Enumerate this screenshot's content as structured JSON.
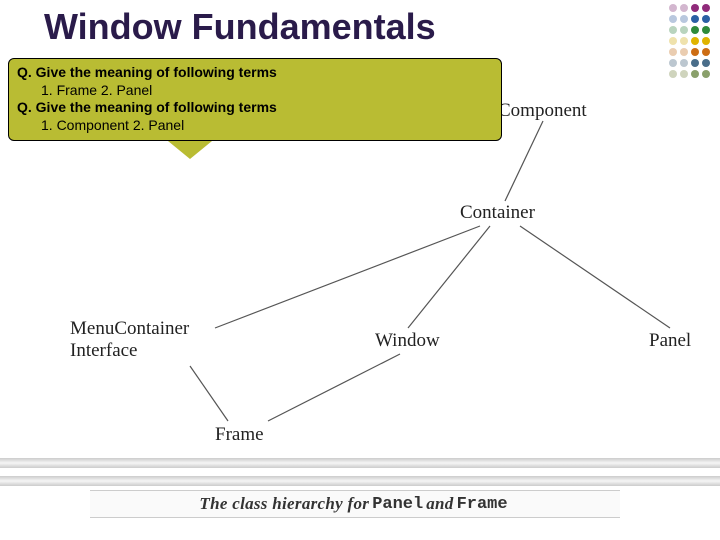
{
  "title": "Window Fundamentals",
  "callout": {
    "q1": "Q.  Give the meaning of following terms",
    "q1_items": "1.  Frame 2.  Panel",
    "q2": "Q.  Give the meaning of following terms",
    "q2_items": "1.  Component 2.  Panel"
  },
  "nodes": {
    "component": "Component",
    "container": "Container",
    "menucontainer_l1": "MenuContainer",
    "menucontainer_l2": "Interface",
    "window": "Window",
    "panel": "Panel",
    "frame": "Frame"
  },
  "caption": {
    "pre": "The class hierarchy for ",
    "kw1": "Panel",
    "mid": " and ",
    "kw2": "Frame"
  },
  "dot_deco": {
    "fill_colors": [
      "#902a7a",
      "#2b5fa3",
      "#2f8a3a",
      "#e0b400",
      "#cc6d15",
      "#4a6e8a",
      "#8aa06b"
    ],
    "ring_colors": [
      "#d3b7cf",
      "#b9c8de",
      "#b9d4be",
      "#efe2ad",
      "#eacdb1",
      "#bcc7d0",
      "#cfd4bd"
    ]
  }
}
